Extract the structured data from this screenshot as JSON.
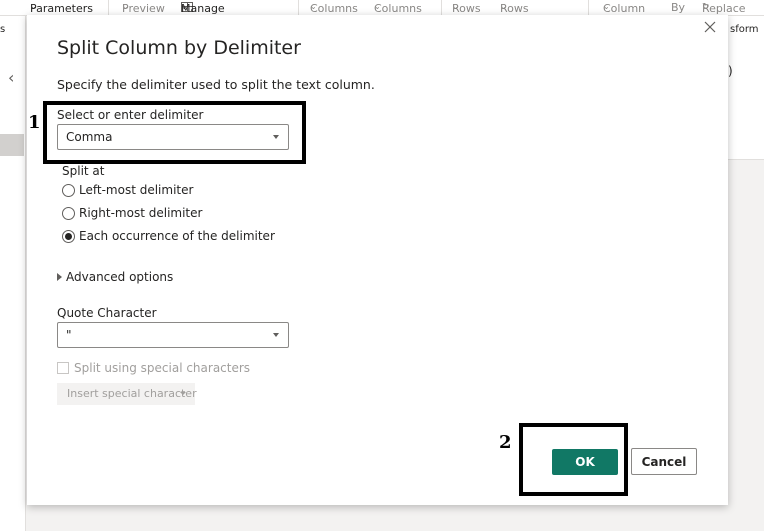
{
  "ribbon": {
    "parameters": "Parameters",
    "preview": "Preview",
    "manage": "Manage",
    "columns1": "Columns",
    "columns2": "Columns",
    "rows1": "Rows",
    "rows2": "Rows",
    "column": "Column",
    "by": "By",
    "replace": "Replace",
    "left_edge": "s",
    "transform_edge": "sform"
  },
  "dialog": {
    "title": "Split Column by Delimiter",
    "subtitle": "Specify the delimiter used to split the text column.",
    "delimiter_label": "Select or enter delimiter",
    "delimiter_value": "Comma",
    "split_at_label": "Split at",
    "split_options": [
      {
        "label": "Left-most delimiter",
        "checked": false
      },
      {
        "label": "Right-most delimiter",
        "checked": false
      },
      {
        "label": "Each occurrence of the delimiter",
        "checked": true
      }
    ],
    "advanced_label": "Advanced options",
    "quote_label": "Quote Character",
    "quote_value": "\"",
    "special_chars_label": "Split using special characters",
    "insert_special_label": "Insert special character",
    "ok_label": "OK",
    "cancel_label": "Cancel"
  },
  "right_pane": {
    "paren": ")"
  },
  "annotations": {
    "one": "1",
    "two": "2"
  },
  "colors": {
    "ok_button": "#117865",
    "annotation": "#000000"
  }
}
